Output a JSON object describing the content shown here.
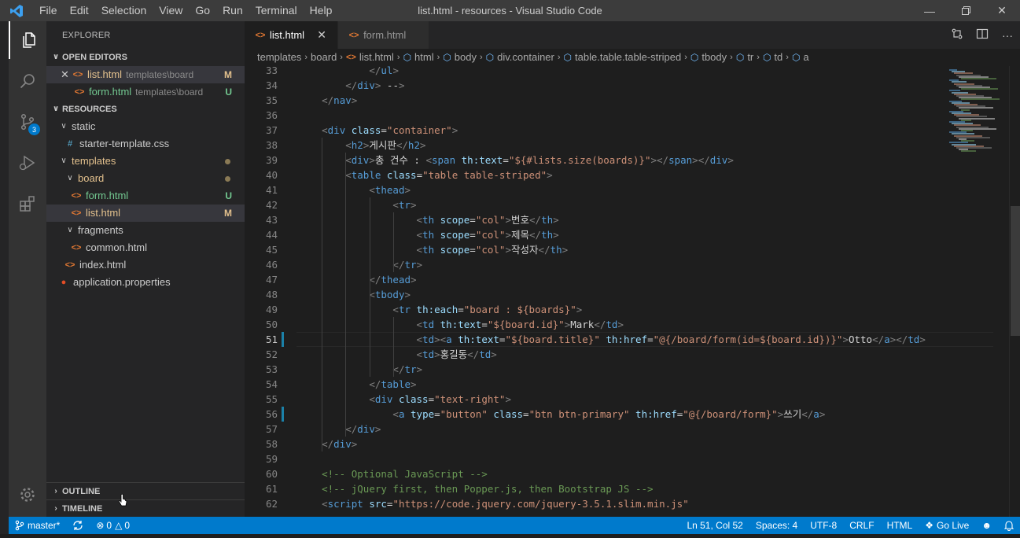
{
  "window": {
    "title": "list.html - resources - Visual Studio Code",
    "menu": [
      "File",
      "Edit",
      "Selection",
      "View",
      "Go",
      "Run",
      "Terminal",
      "Help"
    ]
  },
  "activity": {
    "scm_badge": "3"
  },
  "sidebar": {
    "title": "EXPLORER",
    "open_editors_label": "OPEN EDITORS",
    "open_editors": [
      {
        "name": "list.html",
        "desc": "templates\\board",
        "status": "M"
      },
      {
        "name": "form.html",
        "desc": "templates\\board",
        "status": "U"
      }
    ],
    "resources_label": "RESOURCES",
    "tree": [
      {
        "label": "static",
        "type": "folder"
      },
      {
        "label": "starter-template.css",
        "type": "css"
      },
      {
        "label": "templates",
        "type": "folder"
      },
      {
        "label": "board",
        "type": "folder"
      },
      {
        "label": "form.html",
        "type": "html",
        "status": "U"
      },
      {
        "label": "list.html",
        "type": "html",
        "status": "M"
      },
      {
        "label": "fragments",
        "type": "folder"
      },
      {
        "label": "common.html",
        "type": "html"
      },
      {
        "label": "index.html",
        "type": "html"
      },
      {
        "label": "application.properties",
        "type": "prop"
      }
    ],
    "outline_label": "OUTLINE",
    "timeline_label": "TIMELINE"
  },
  "tabs": [
    {
      "label": "list.html",
      "active": true
    },
    {
      "label": "form.html",
      "active": false
    }
  ],
  "breadcrumb": [
    "templates",
    "board",
    "list.html",
    "html",
    "body",
    "div.container",
    "table.table.table-striped",
    "tbody",
    "tr",
    "td",
    "a"
  ],
  "code": {
    "line_numbers": [
      "33",
      "34",
      "35",
      "36",
      "37",
      "38",
      "39",
      "40",
      "41",
      "42",
      "43",
      "44",
      "45",
      "46",
      "47",
      "48",
      "49",
      "50",
      "51",
      "52",
      "53",
      "54",
      "55",
      "56",
      "57",
      "58",
      "59",
      "60",
      "61",
      "62"
    ],
    "active_line": "51"
  },
  "status": {
    "branch": "master*",
    "errors": "0",
    "warnings": "0",
    "position": "Ln 51, Col 52",
    "spaces": "Spaces: 4",
    "encoding": "UTF-8",
    "eol": "CRLF",
    "language": "HTML",
    "golive": "Go Live"
  }
}
